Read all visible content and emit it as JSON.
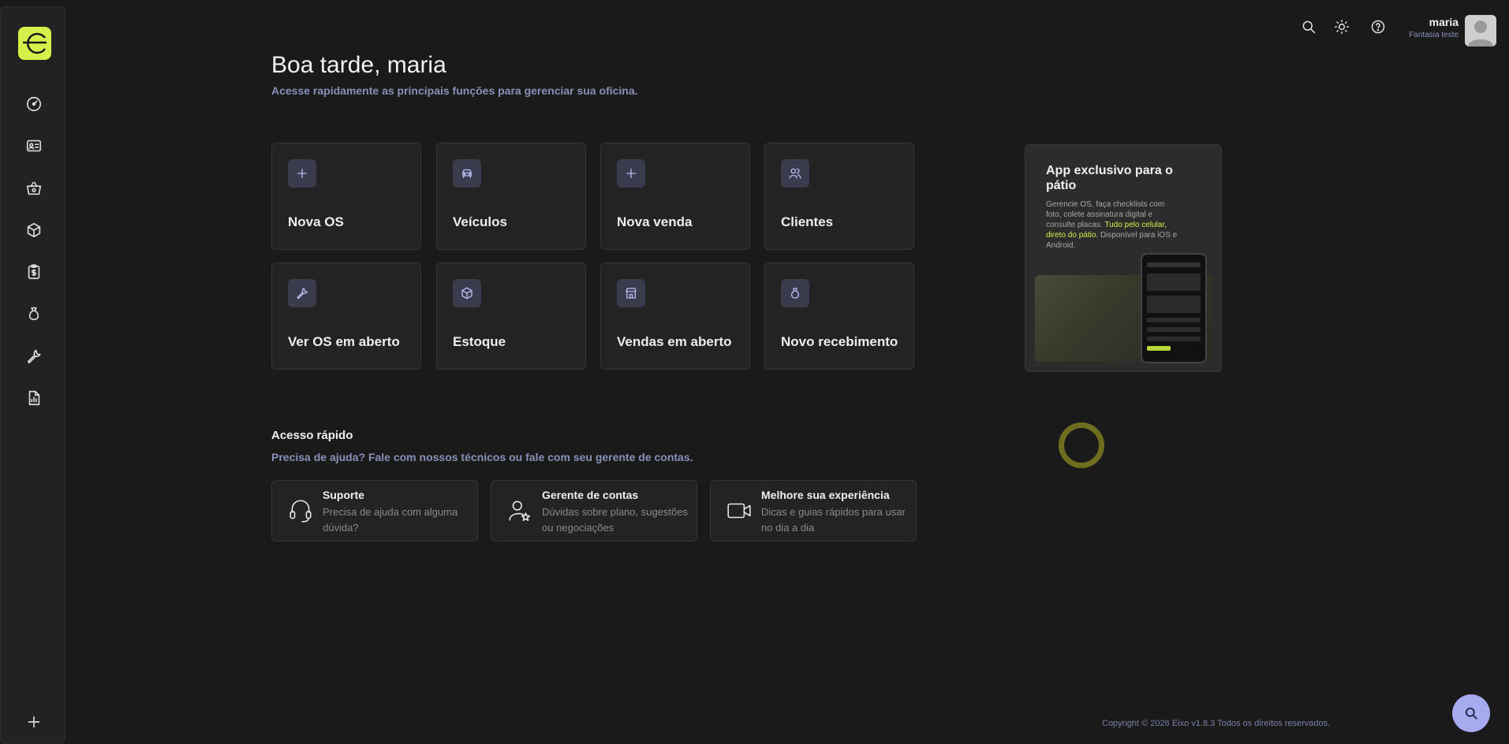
{
  "user": {
    "name": "maria",
    "company": "Fantasia teste"
  },
  "header": {
    "greeting": "Boa tarde, maria",
    "subtitle": "Acesse rapidamente as principais funções para gerenciar sua oficina."
  },
  "sidebar": {
    "logo_letter": "e",
    "items": [
      {
        "icon": "dashboard-icon"
      },
      {
        "icon": "service-order-icon"
      },
      {
        "icon": "shopping-basket-icon"
      },
      {
        "icon": "box-icon"
      },
      {
        "icon": "clipboard-dollar-icon"
      },
      {
        "icon": "money-bag-icon"
      },
      {
        "icon": "wrench-icon"
      },
      {
        "icon": "report-icon"
      }
    ],
    "add_icon": "plus-icon"
  },
  "shortcuts": [
    {
      "label": "Nova OS",
      "icon": "plus-icon"
    },
    {
      "label": "Veículos",
      "icon": "car-icon"
    },
    {
      "label": "Nova venda",
      "icon": "plus-icon"
    },
    {
      "label": "Clientes",
      "icon": "users-icon"
    },
    {
      "label": "Ver OS em aberto",
      "icon": "wrench-icon"
    },
    {
      "label": "Estoque",
      "icon": "box-icon"
    },
    {
      "label": "Vendas em aberto",
      "icon": "store-icon"
    },
    {
      "label": "Novo recebimento",
      "icon": "money-bag-icon"
    }
  ],
  "promo": {
    "title": "App exclusivo para o pátio",
    "text": "Gerencie OS, faça checklists com foto, colete assinatura digital e consulte placas.",
    "highlight": "Tudo pelo celular, direto do pátio.",
    "text_end": "Disponível para iOS e Android."
  },
  "quick_access": {
    "title": "Acesso rápido",
    "subtitle": "Precisa de ajuda? Fale com nossos técnicos ou fale com seu gerente de contas.",
    "cards": [
      {
        "title": "Suporte",
        "desc": "Precisa de ajuda com alguma dúvida?",
        "icon": "headset-icon"
      },
      {
        "title": "Gerente de contas",
        "desc": "Dúvidas sobre plano, sugestões ou negociações",
        "icon": "user-star-icon"
      },
      {
        "title": "Melhore sua experiência",
        "desc": "Dicas e guias rápidos para usar no dia a dia",
        "icon": "video-icon"
      }
    ]
  },
  "footer": "Copyright © 2026 Eixo v1.8.3 Todos os direitos reservados.",
  "colors": {
    "accent": "#d4f04a",
    "background": "#1a1a1a",
    "card": "#232323",
    "icon_tint": "#b8bcf0",
    "fab": "#a6aaee"
  }
}
